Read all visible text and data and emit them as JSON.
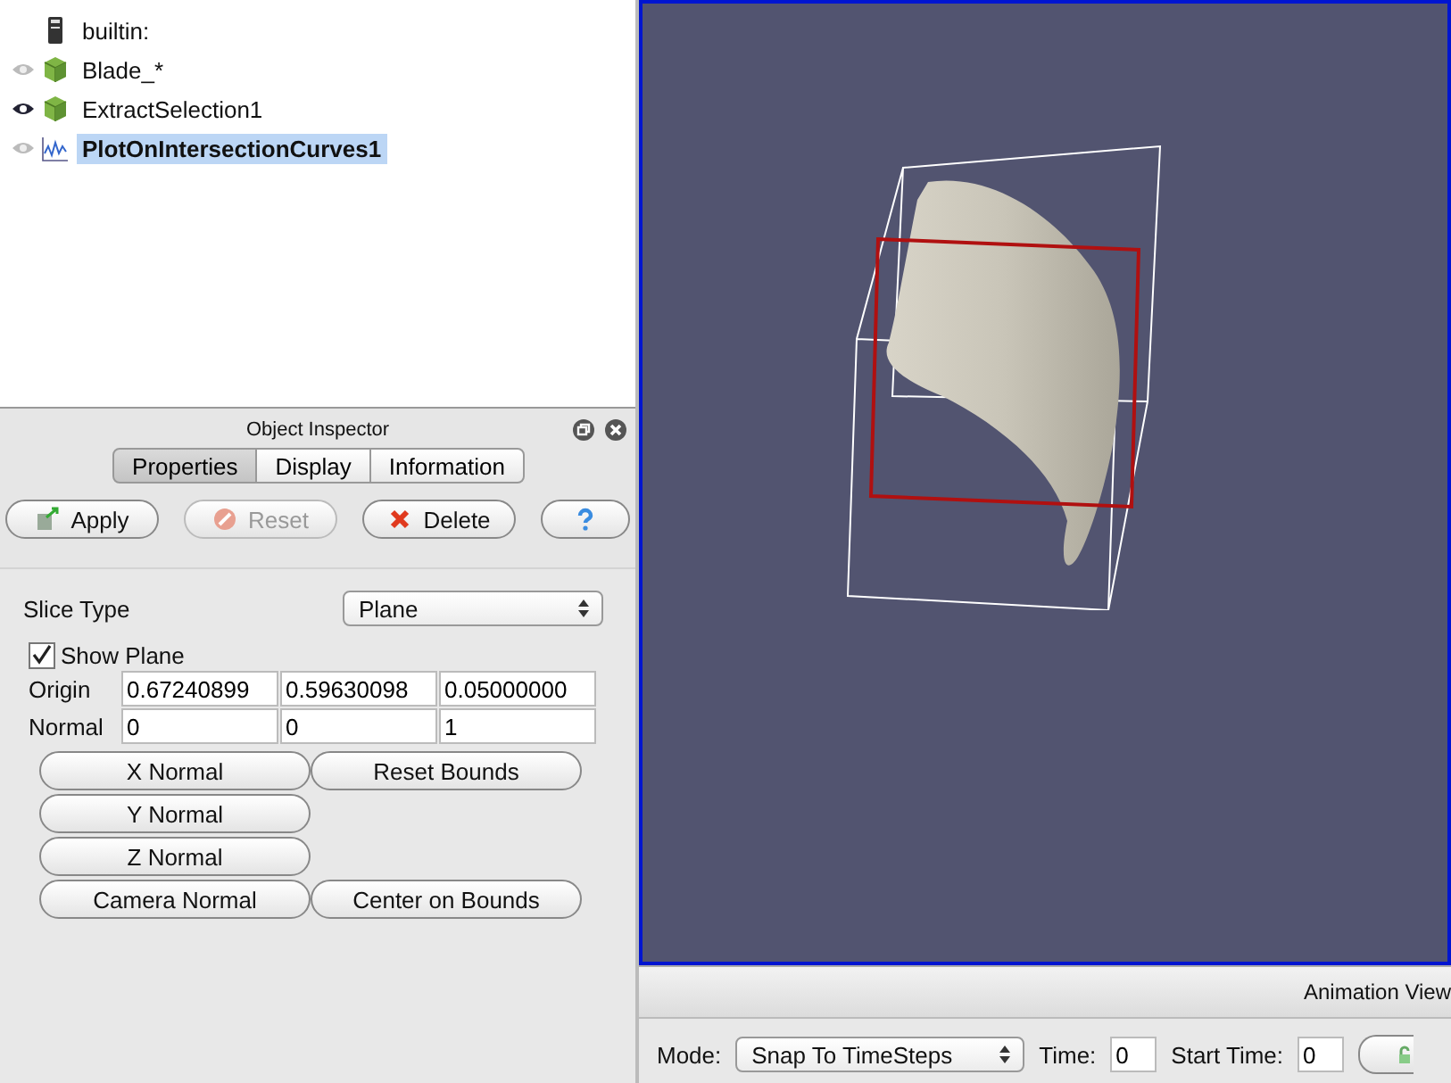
{
  "pipeline": {
    "items": [
      {
        "label": "builtin:",
        "kind": "server",
        "selected": false
      },
      {
        "label": "Blade_*",
        "kind": "dataset",
        "visible": false,
        "selected": false
      },
      {
        "label": "ExtractSelection1",
        "kind": "dataset",
        "visible": true,
        "selected": false
      },
      {
        "label": "PlotOnIntersectionCurves1",
        "kind": "plot",
        "visible": false,
        "selected": true
      }
    ]
  },
  "inspector": {
    "title": "Object Inspector",
    "tabs": [
      {
        "label": "Properties",
        "selected": true
      },
      {
        "label": "Display",
        "selected": false
      },
      {
        "label": "Information",
        "selected": false
      }
    ],
    "actions": [
      {
        "label": "Apply",
        "kind": "apply",
        "disabled": false
      },
      {
        "label": "Reset",
        "kind": "reset",
        "disabled": true
      },
      {
        "label": "Delete",
        "kind": "delete",
        "disabled": false
      },
      {
        "kind": "help",
        "disabled": false
      }
    ],
    "slice_type": {
      "label": "Slice Type",
      "value": "Plane"
    },
    "show_plane": {
      "label": "Show Plane",
      "checked": true
    },
    "origin": {
      "label": "Origin",
      "values": [
        "0.67240899",
        "0.59630098",
        "0.05000000"
      ]
    },
    "normal": {
      "label": "Normal",
      "values": [
        "0",
        "0",
        "1"
      ]
    },
    "plane_buttons": [
      [
        "X Normal",
        "Reset Bounds"
      ],
      [
        "Y Normal"
      ],
      [
        "Z Normal"
      ],
      [
        "Camera Normal",
        "Center on Bounds"
      ]
    ]
  },
  "animation_view": {
    "title": "Animation View",
    "mode_label": "Mode:",
    "mode": "Snap To TimeSteps",
    "time_label": "Time:",
    "time": "0",
    "start_time_label": "Start Time:",
    "start_time": "0"
  }
}
